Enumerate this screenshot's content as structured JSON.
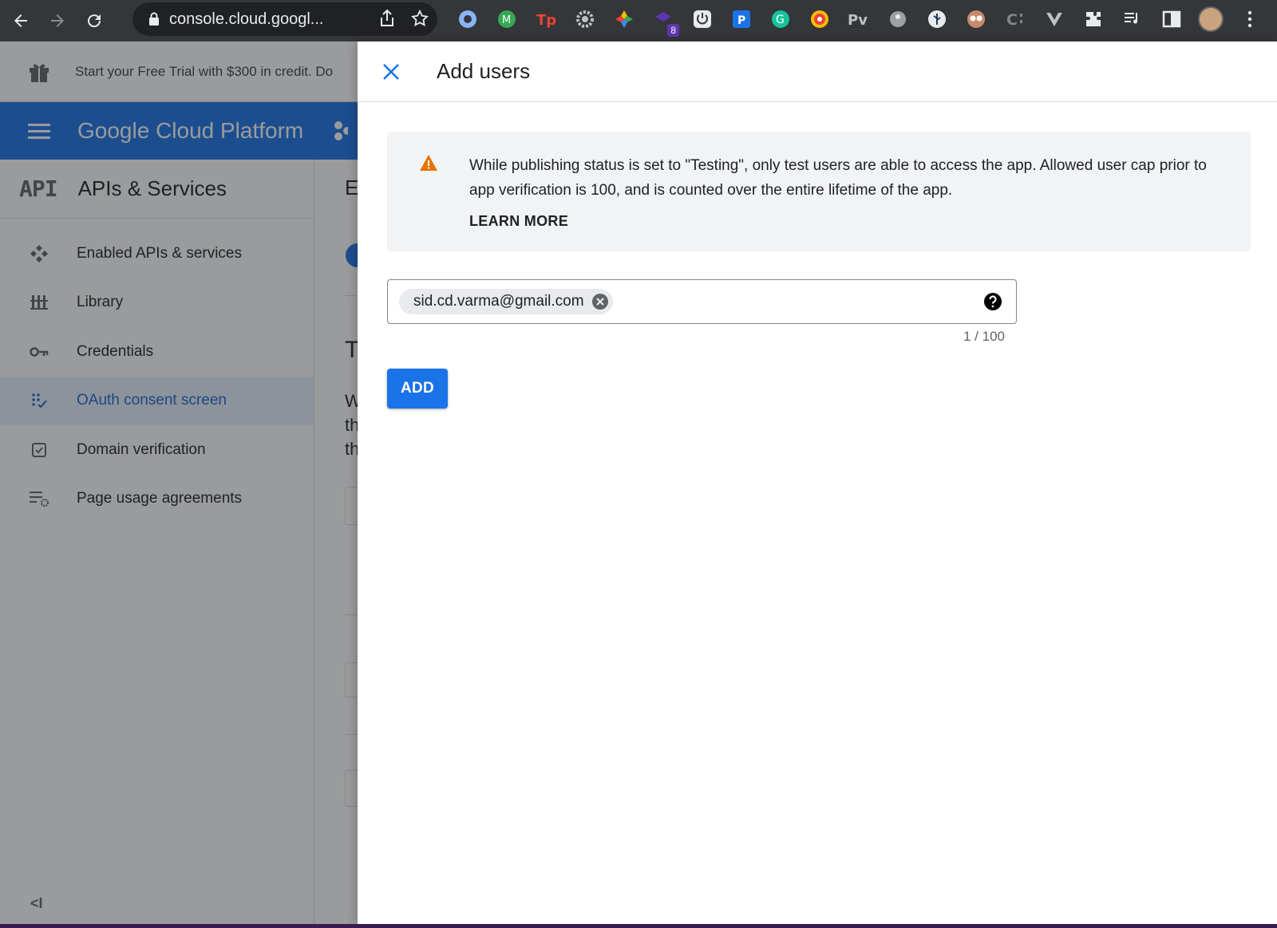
{
  "browser": {
    "url": "console.cloud.googl...",
    "extension_badge": "8"
  },
  "background": {
    "promo_text": "Start your Free Trial with $300 in credit. Do",
    "app_title": "Google Cloud Platform",
    "section_logo": "API",
    "section_title": "APIs & Services",
    "sidebar_items": [
      {
        "label": "Enabled APIs & services",
        "icon": "api-icon"
      },
      {
        "label": "Library",
        "icon": "library-icon"
      },
      {
        "label": "Credentials",
        "icon": "key-icon"
      },
      {
        "label": "OAuth consent screen",
        "icon": "consent-icon",
        "active": true
      },
      {
        "label": "Domain verification",
        "icon": "checkbox-icon"
      },
      {
        "label": "Page usage agreements",
        "icon": "settings-list-icon"
      }
    ],
    "collapse_label": "<I",
    "content_letters": [
      "E",
      "T",
      "W",
      "th",
      "th"
    ]
  },
  "drawer": {
    "title": "Add users",
    "notice": {
      "text": "While publishing status is set to \"Testing\", only test users are able to access the app. Allowed user cap prior to app verification is 100, and is counted over the entire lifetime of the app.",
      "link": "LEARN MORE"
    },
    "chips": [
      "sid.cd.varma@gmail.com"
    ],
    "counter": "1 / 100",
    "add_label": "ADD"
  },
  "colors": {
    "accent": "#1a73e8",
    "warning": "#e37400",
    "chrome": "#35363a"
  }
}
